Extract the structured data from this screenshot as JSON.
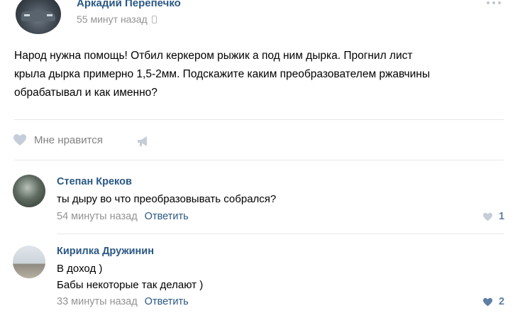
{
  "post": {
    "author": "Аркадий Перепечко",
    "time": "55 минут назад",
    "text": "Народ нужна помощь! Отбил керкером рыжик а под ним дырка. Прогнил лист\nкрыла дырка примерно 1,5-2мм. Подскажите каким преобразователем ржавчины\nобрабатывал и как именно?",
    "like_label": "Мне нравится"
  },
  "comments": [
    {
      "author": "Степан Креков",
      "text": "ты дыру во что преобразовывать собрался?",
      "time": "54 минуты назад",
      "reply_label": "Ответить",
      "likes": "1"
    },
    {
      "author": "Кирилка Дружинин",
      "text": "В доход )\nБабы некоторые так делают )",
      "time": "33 минуты назад",
      "reply_label": "Ответить",
      "likes": "2"
    }
  ],
  "colors": {
    "link": "#2a5885",
    "muted": "#939393",
    "icon": "#c0c6cd",
    "like_active": "#5e7ea4",
    "divider": "#e7e8ec"
  },
  "icons": [
    "phone-icon",
    "more-icon",
    "heart-icon",
    "megaphone-icon"
  ]
}
